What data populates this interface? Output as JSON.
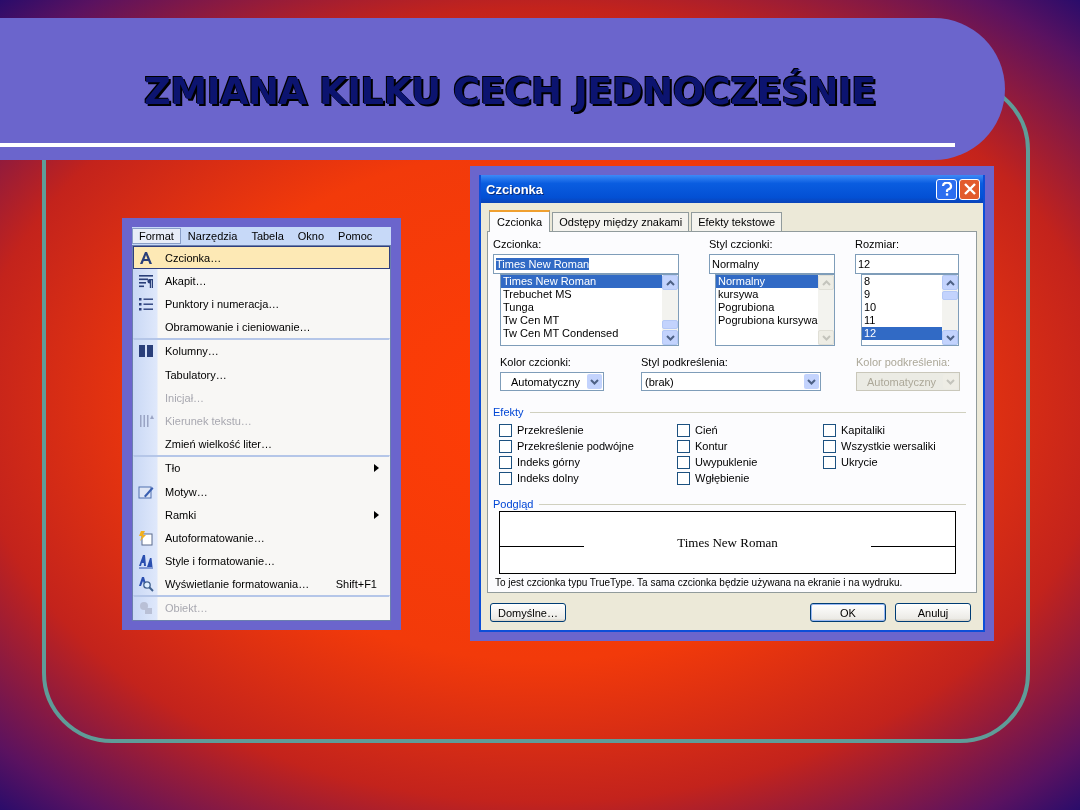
{
  "slide": {
    "title": "ZMIANA KILKU CECH JEDNOCZEŚNIE"
  },
  "menu": {
    "bar": [
      {
        "label": "Format",
        "selected": true
      },
      {
        "label": "Narzędzia",
        "selected": false
      },
      {
        "label": "Tabela",
        "selected": false
      },
      {
        "label": "Okno",
        "selected": false
      },
      {
        "label": "Pomoc",
        "selected": false
      }
    ],
    "items": [
      {
        "label": "Czcionka…",
        "kind": "font",
        "selected": true,
        "disabled": false,
        "separator_before": false
      },
      {
        "label": "Akapit…",
        "kind": "paragraph",
        "selected": false,
        "disabled": false,
        "separator_before": false
      },
      {
        "label": "Punktory i numeracja…",
        "kind": "list",
        "selected": false,
        "disabled": false,
        "separator_before": false
      },
      {
        "label": "Obramowanie i cieniowanie…",
        "selected": false,
        "disabled": false,
        "separator_before": false
      },
      {
        "label": "Kolumny…",
        "kind": "columns",
        "selected": false,
        "disabled": false,
        "separator_before": true
      },
      {
        "label": "Tabulatory…",
        "selected": false,
        "disabled": false,
        "separator_before": false
      },
      {
        "label": "Inicjał…",
        "selected": false,
        "disabled": true,
        "separator_before": false
      },
      {
        "label": "Kierunek tekstu…",
        "kind": "direction",
        "selected": false,
        "disabled": true,
        "separator_before": false
      },
      {
        "label": "Zmień wielkość liter…",
        "selected": false,
        "disabled": false,
        "separator_before": false
      },
      {
        "label": "Tło",
        "submenu": true,
        "selected": false,
        "disabled": false,
        "separator_before": true
      },
      {
        "label": "Motyw…",
        "kind": "theme",
        "selected": false,
        "disabled": false,
        "separator_before": false
      },
      {
        "label": "Ramki",
        "submenu": true,
        "selected": false,
        "disabled": false,
        "separator_before": false
      },
      {
        "label": "Autoformatowanie…",
        "kind": "autoformat",
        "selected": false,
        "disabled": false,
        "separator_before": false
      },
      {
        "label": "Style i formatowanie…",
        "kind": "styles",
        "selected": false,
        "disabled": false,
        "separator_before": false
      },
      {
        "label": "Wyświetlanie formatowania…",
        "shortcut": "Shift+F1",
        "kind": "reveal",
        "selected": false,
        "disabled": false,
        "separator_before": false
      },
      {
        "label": "Obiekt…",
        "kind": "object",
        "selected": false,
        "disabled": true,
        "separator_before": true
      }
    ]
  },
  "dialog": {
    "title": "Czcionka",
    "tabs": [
      {
        "label": "Czcionka",
        "selected": true
      },
      {
        "label": "Odstępy między znakami",
        "selected": false
      },
      {
        "label": "Efekty tekstowe",
        "selected": false
      }
    ],
    "pickers": [
      {
        "label": "Czcionka:",
        "value": "Times New Roman",
        "value_selected": true,
        "scrollbar_disabled": false,
        "items": [
          {
            "label": "Times New Roman",
            "selected": true
          },
          {
            "label": "Trebuchet MS",
            "selected": false
          },
          {
            "label": "Tunga",
            "selected": false
          },
          {
            "label": "Tw Cen MT",
            "selected": false
          },
          {
            "label": "Tw Cen MT Condensed",
            "selected": false
          }
        ]
      },
      {
        "label": "Styl czcionki:",
        "value": "Normalny",
        "value_selected": false,
        "scrollbar_disabled": true,
        "items": [
          {
            "label": "Normalny",
            "selected": true
          },
          {
            "label": "kursywa",
            "selected": false
          },
          {
            "label": "Pogrubiona",
            "selected": false
          },
          {
            "label": "Pogrubiona kursywa",
            "selected": false
          }
        ]
      },
      {
        "label": "Rozmiar:",
        "value": "12",
        "value_selected": false,
        "scrollbar_disabled": false,
        "items": [
          {
            "label": "8",
            "selected": false
          },
          {
            "label": "9",
            "selected": false
          },
          {
            "label": "10",
            "selected": false
          },
          {
            "label": "11",
            "selected": false
          },
          {
            "label": "12",
            "selected": true
          }
        ]
      }
    ],
    "combos": [
      {
        "label": "Kolor czcionki:",
        "value": "Automatyczny",
        "disabled": false
      },
      {
        "label": "Styl podkreślenia:",
        "value": "(brak)",
        "disabled": false
      },
      {
        "label": "Kolor podkreślenia:",
        "value": "Automatyczny",
        "disabled": true
      }
    ],
    "effects_title": "Efekty",
    "effects": [
      [
        {
          "label": "Przekreślenie",
          "checked": false
        },
        {
          "label": "Przekreślenie podwójne",
          "checked": false
        },
        {
          "label": "Indeks górny",
          "checked": false
        },
        {
          "label": "Indeks dolny",
          "checked": false
        }
      ],
      [
        {
          "label": "Cień",
          "checked": false
        },
        {
          "label": "Kontur",
          "checked": false
        },
        {
          "label": "Uwypuklenie",
          "checked": false
        },
        {
          "label": "Wgłębienie",
          "checked": false
        }
      ],
      [
        {
          "label": "Kapitaliki",
          "checked": false
        },
        {
          "label": "Wszystkie wersaliki",
          "checked": false
        },
        {
          "label": "Ukrycie",
          "checked": false
        }
      ]
    ],
    "preview_title": "Podgląd",
    "preview_text": "Times New Roman",
    "note": "To jest czcionka typu TrueType. Ta sama czcionka będzie używana na ekranie i na wydruku.",
    "buttons": [
      {
        "label": "Domyślne…",
        "kind": "left",
        "default": false
      },
      {
        "label": "OK",
        "kind": "right",
        "default": true
      },
      {
        "label": "Anuluj",
        "kind": "right",
        "default": false
      }
    ]
  }
}
